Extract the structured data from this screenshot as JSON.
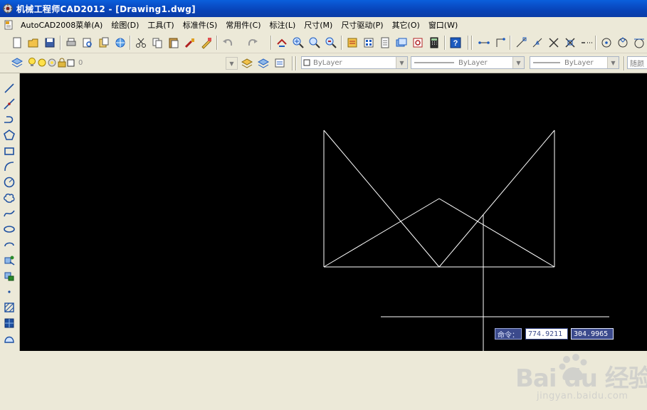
{
  "window": {
    "title": "机械工程师CAD2012 - [Drawing1.dwg]"
  },
  "menu": {
    "items": [
      "AutoCAD2008菜单(A)",
      "绘图(D)",
      "工具(T)",
      "标准件(S)",
      "常用件(C)",
      "标注(L)",
      "尺寸(M)",
      "尺寸驱动(P)",
      "其它(O)",
      "窗口(W)"
    ]
  },
  "layer_toolbar": {
    "layer_name": "0",
    "color": "ByLayer",
    "linetype": "ByLayer",
    "lineweight": "ByLayer",
    "plotstyle": "随颜"
  },
  "command": {
    "prompt": "命令：",
    "coord_x": "774.9211",
    "coord_y": "304.9965"
  },
  "watermark": {
    "brand": "Bai du 经验",
    "url": "jingyan.baidu.com"
  },
  "colors": {
    "canvas": "#000000",
    "geometry": "#ffffff",
    "title_bar": "#0a48c4",
    "chrome": "#ece9d8"
  }
}
